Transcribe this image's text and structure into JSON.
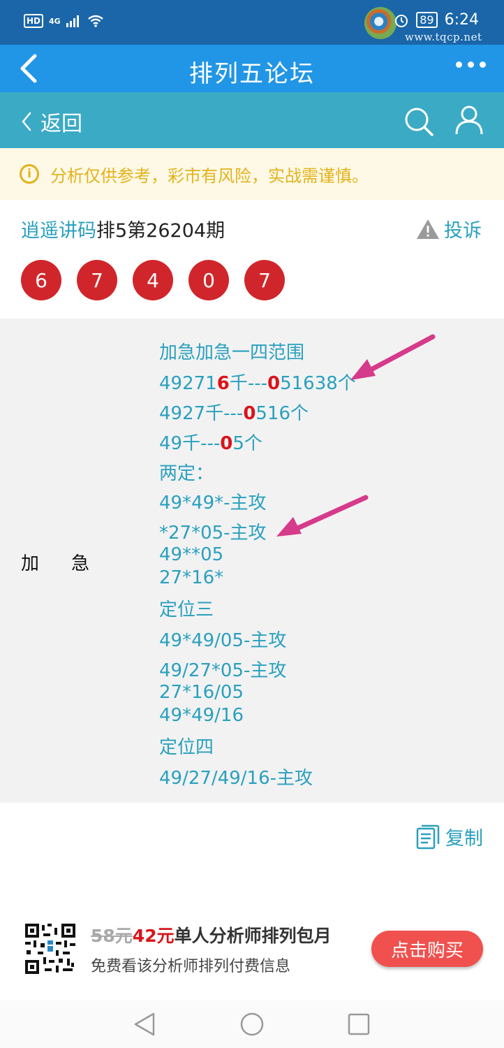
{
  "status_bar": {
    "hd": "HD",
    "network": "4G",
    "battery": "89",
    "time": "6:24",
    "watermark": "www.tqcp.net"
  },
  "header": {
    "title": "排列五论坛"
  },
  "subbar": {
    "back_label": "返回"
  },
  "notice": {
    "text": "分析仅供参考，彩市有风险，实战需谨慎。"
  },
  "post": {
    "author": "逍遥讲码",
    "title": "排5第26204期",
    "complain_label": "投诉",
    "numbers": [
      "6",
      "7",
      "4",
      "0",
      "7"
    ],
    "row_label_parts": [
      "加",
      "急"
    ],
    "lines": {
      "l1": "加急加急一四范围",
      "l2": {
        "a": "49271",
        "b": "6",
        "c": "千---",
        "d": "0",
        "e": "51638个"
      },
      "l3": {
        "a": "4927千---",
        "b": "0",
        "c": "516个"
      },
      "l4": {
        "a": "49千---",
        "b": "0",
        "c": "5个"
      },
      "l5": "两定：",
      "l6": "49*49*-主攻",
      "l7": "*27*05-主攻",
      "l8": "49**05",
      "l9": "27*16*",
      "l10": "定位三",
      "l11": "49*49/05-主攻",
      "l12": "49/27*05-主攻",
      "l13": "27*16/05",
      "l14": "49*49/16",
      "l15": "定位四",
      "l16": "49/27/49/16-主攻"
    },
    "copy_label": "复制"
  },
  "ad": {
    "old_price": "58元",
    "new_price": "42元",
    "product": "单人分析师排列包月",
    "desc": "免费看该分析师排列付费信息",
    "buy_label": "点击购买"
  },
  "colors": {
    "accent": "#2aa0bd",
    "header": "#2196e6",
    "ball": "#d0262b",
    "highlight": "#d9141a"
  }
}
